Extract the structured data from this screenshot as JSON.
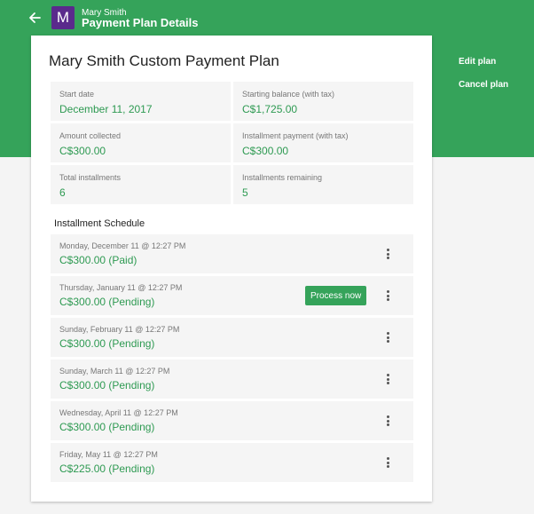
{
  "header": {
    "avatar_letter": "M",
    "customer_name": "Mary Smith",
    "title": "Payment Plan Details",
    "back_icon": "arrow-left-icon"
  },
  "side_actions": {
    "edit_label": "Edit plan",
    "cancel_label": "Cancel plan"
  },
  "plan": {
    "title": "Mary Smith Custom Payment Plan",
    "summary": [
      {
        "label": "Start date",
        "value": "December 11, 2017"
      },
      {
        "label": "Starting balance (with tax)",
        "value": "C$1,725.00"
      },
      {
        "label": "Amount collected",
        "value": "C$300.00"
      },
      {
        "label": "Installment payment (with tax)",
        "value": "C$300.00"
      },
      {
        "label": "Total installments",
        "value": "6"
      },
      {
        "label": "Installments remaining",
        "value": "5"
      }
    ]
  },
  "schedule": {
    "heading": "Installment Schedule",
    "process_label": "Process now",
    "rows": [
      {
        "date": "Monday, December 11 @ 12:27 PM",
        "amount": "C$300.00 (Paid)"
      },
      {
        "date": "Thursday, January 11 @ 12:27 PM",
        "amount": "C$300.00 (Pending)"
      },
      {
        "date": "Sunday, February 11 @ 12:27 PM",
        "amount": "C$300.00 (Pending)"
      },
      {
        "date": "Sunday, March 11 @ 12:27 PM",
        "amount": "C$300.00 (Pending)"
      },
      {
        "date": "Wednesday, April 11 @ 12:27 PM",
        "amount": "C$300.00 (Pending)"
      },
      {
        "date": "Friday, May 11 @ 12:27 PM",
        "amount": "C$225.00 (Pending)"
      }
    ]
  },
  "colors": {
    "brand_green": "#35a35a",
    "value_green": "#2e9a52",
    "avatar_purple": "#5a2a8c"
  }
}
